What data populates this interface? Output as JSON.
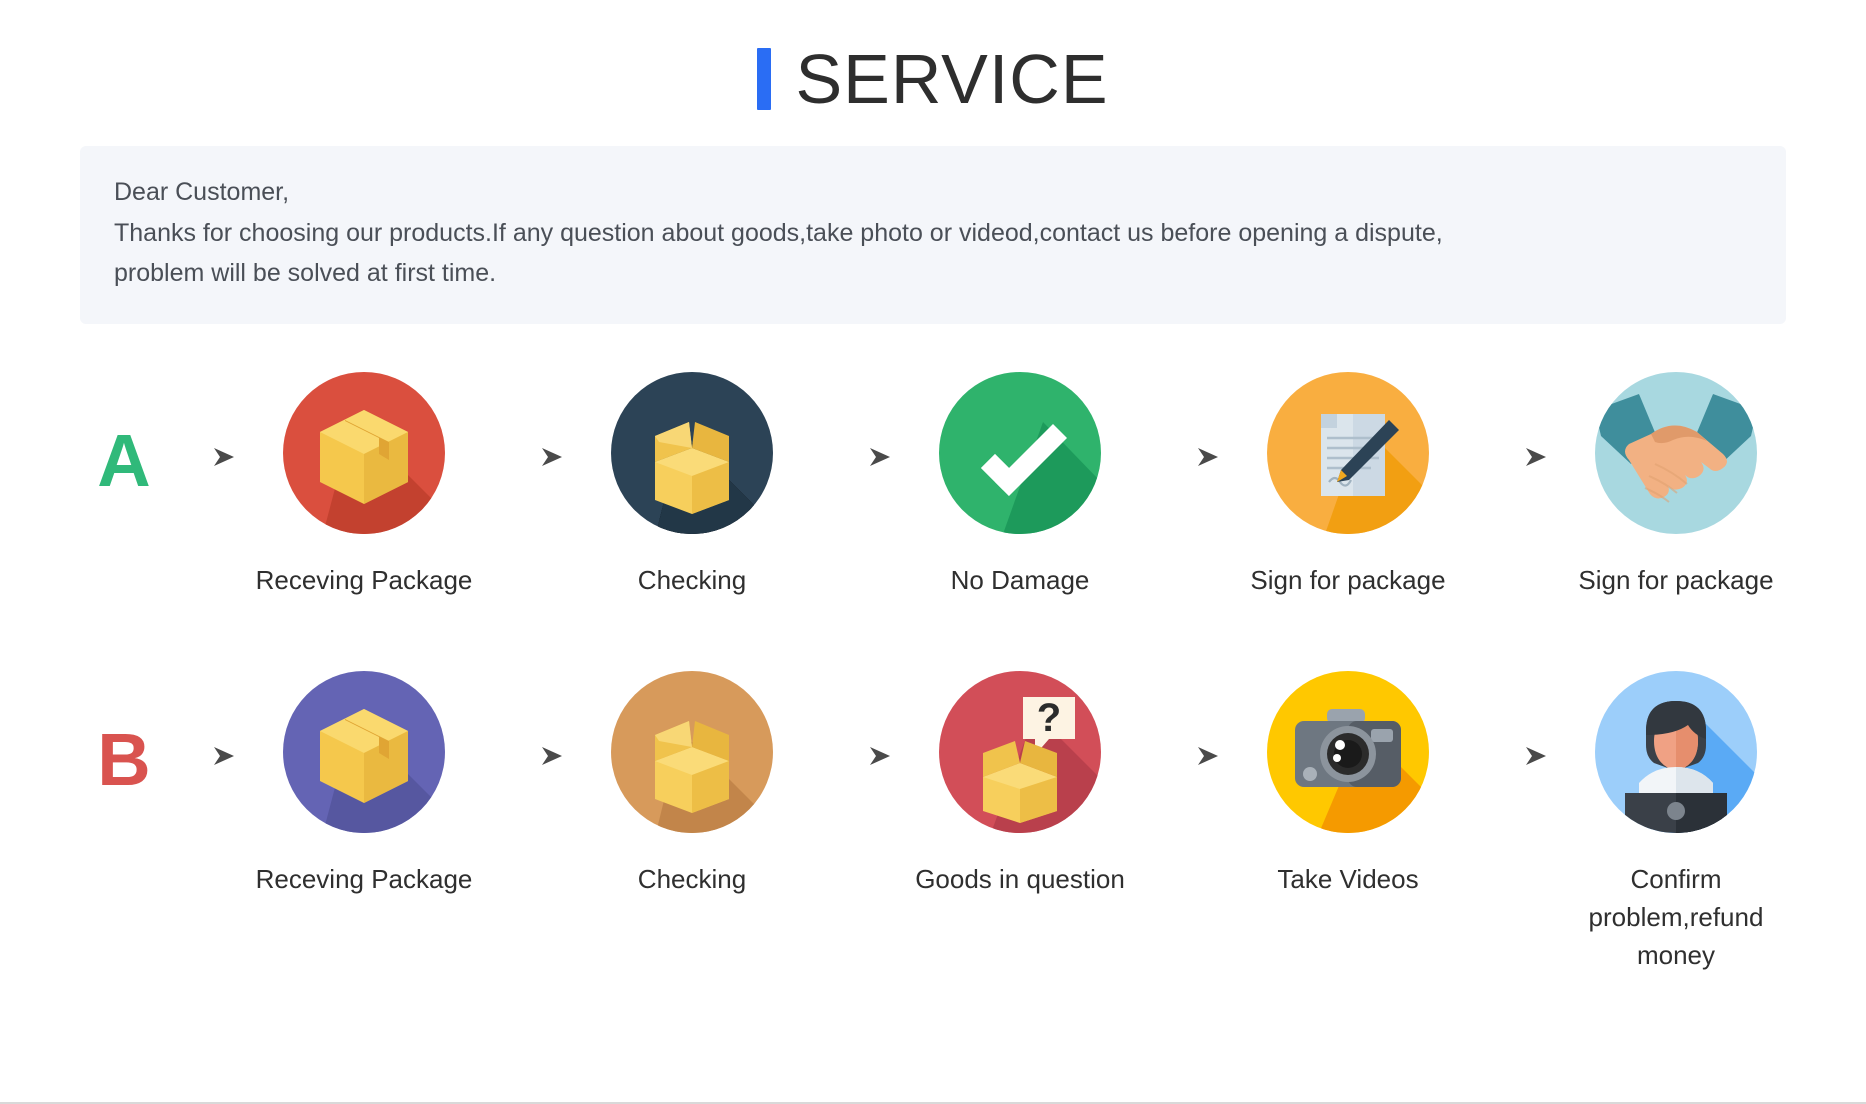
{
  "header": {
    "title": "SERVICE",
    "accent_color": "#2a6df4"
  },
  "notice": {
    "line1": "Dear Customer,",
    "line2": "Thanks for choosing our products.If any question about goods,take photo or videod,contact us before opening a dispute,",
    "line3": "problem will be solved at first time.",
    "background_color": "#f4f6fa"
  },
  "flows": [
    {
      "badge": "A",
      "badge_color": "#30b97a",
      "steps": [
        {
          "label": "Receving Package",
          "icon": "closed-package-icon",
          "circle_color": "#da4f3e"
        },
        {
          "label": "Checking",
          "icon": "open-box-icon",
          "circle_color": "#2c4356"
        },
        {
          "label": "No Damage",
          "icon": "checkmark-icon",
          "circle_color": "#2fb36c"
        },
        {
          "label": "Sign for package",
          "icon": "document-pen-icon",
          "circle_color": "#f9ae40"
        },
        {
          "label": "Sign for package",
          "icon": "handshake-icon",
          "circle_color": "#a8d8e0"
        }
      ]
    },
    {
      "badge": "B",
      "badge_color": "#d9534f",
      "steps": [
        {
          "label": "Receving Package",
          "icon": "closed-package-icon",
          "circle_color": "#6464b4"
        },
        {
          "label": "Checking",
          "icon": "open-box-icon",
          "circle_color": "#d79a5b"
        },
        {
          "label": "Goods in question",
          "icon": "question-box-icon",
          "circle_color": "#d24e58"
        },
        {
          "label": "Take Videos",
          "icon": "camera-icon",
          "circle_color": "#ffc800"
        },
        {
          "label": "Confirm problem,refund money",
          "icon": "support-agent-icon",
          "circle_color": "#9ccefa"
        }
      ]
    }
  ],
  "arrow_glyph": "→"
}
